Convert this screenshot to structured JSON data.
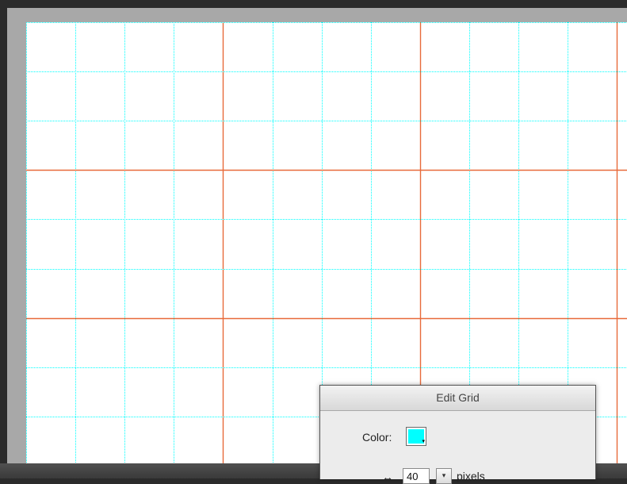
{
  "canvas": {
    "background": "#ffffff",
    "grid_color": "#00ffff",
    "guide_color": "#e86a3a"
  },
  "dialog": {
    "title": "Edit Grid",
    "color_label": "Color:",
    "color_value": "#00ffff",
    "horizontal_spacing_value": "40",
    "unit_label": "pixels",
    "arrow_glyph": "↔",
    "dropdown_glyph": "▾"
  }
}
